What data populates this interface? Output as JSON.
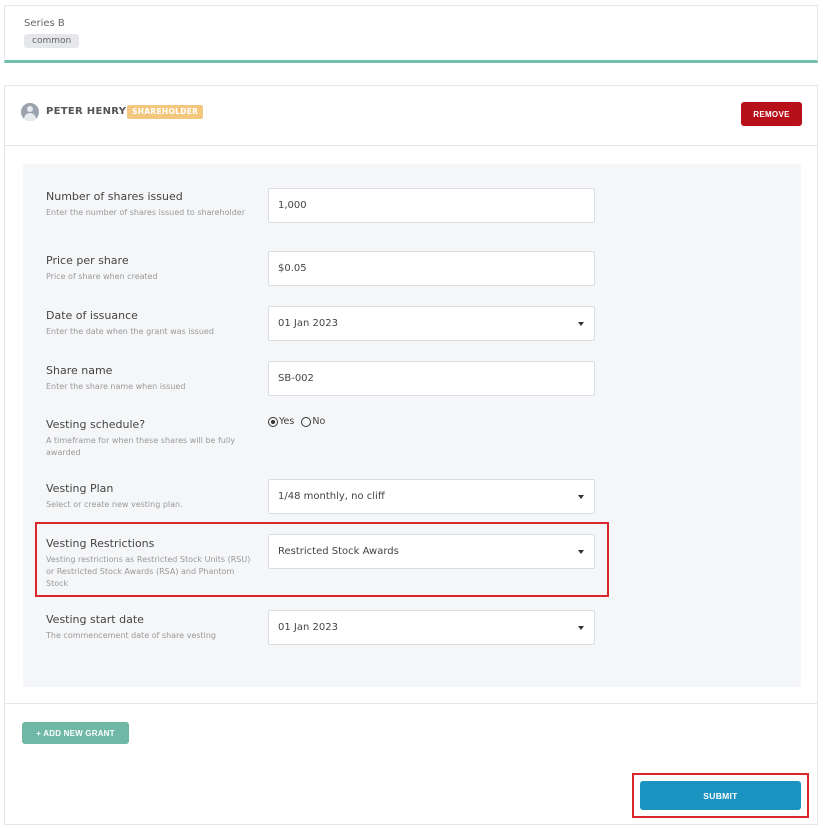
{
  "series": {
    "title": "Series B",
    "chip": "common"
  },
  "holder": {
    "name": "PETER HENRY",
    "role": "SHAREHOLDER",
    "remove_label": "REMOVE"
  },
  "fields": {
    "shares": {
      "label": "Number of shares issued",
      "help": "Enter the number of shares issued to shareholder",
      "value": "1,000"
    },
    "price": {
      "label": "Price per share",
      "help": "Price of share when created",
      "value": "$0.05"
    },
    "issue_date": {
      "label": "Date of issuance",
      "help": "Enter the date when the grant was issued",
      "value": "01 Jan 2023"
    },
    "share_name": {
      "label": "Share name",
      "help": "Enter the share name when issued",
      "value": "SB-002"
    },
    "vesting_schedule": {
      "label": "Vesting schedule?",
      "help": "A timeframe for when these shares will be fully awarded",
      "yes_label": "Yes",
      "no_label": "No",
      "selected": "Yes"
    },
    "vesting_plan": {
      "label": "Vesting Plan",
      "help": "Select or create new vesting plan.",
      "value": "1/48 monthly, no cliff"
    },
    "vesting_restrictions": {
      "label": "Vesting Restrictions",
      "help": "Vesting restrictions as Restricted Stock Units (RSU) or Restricted Stock Awards (RSA) and Phantom Stock",
      "value": "Restricted Stock Awards"
    },
    "vesting_start": {
      "label": "Vesting start date",
      "help": "The commencement date of share vesting",
      "value": "01 Jan 2023"
    }
  },
  "actions": {
    "add_grant_label": "+ ADD NEW GRANT",
    "submit_label": "SUBMIT"
  },
  "colors": {
    "accent_teal": "#6fb8a5",
    "danger": "#b8101a",
    "primary": "#1a93c1",
    "badge": "#f3c77e",
    "highlight": "#d9262c"
  }
}
